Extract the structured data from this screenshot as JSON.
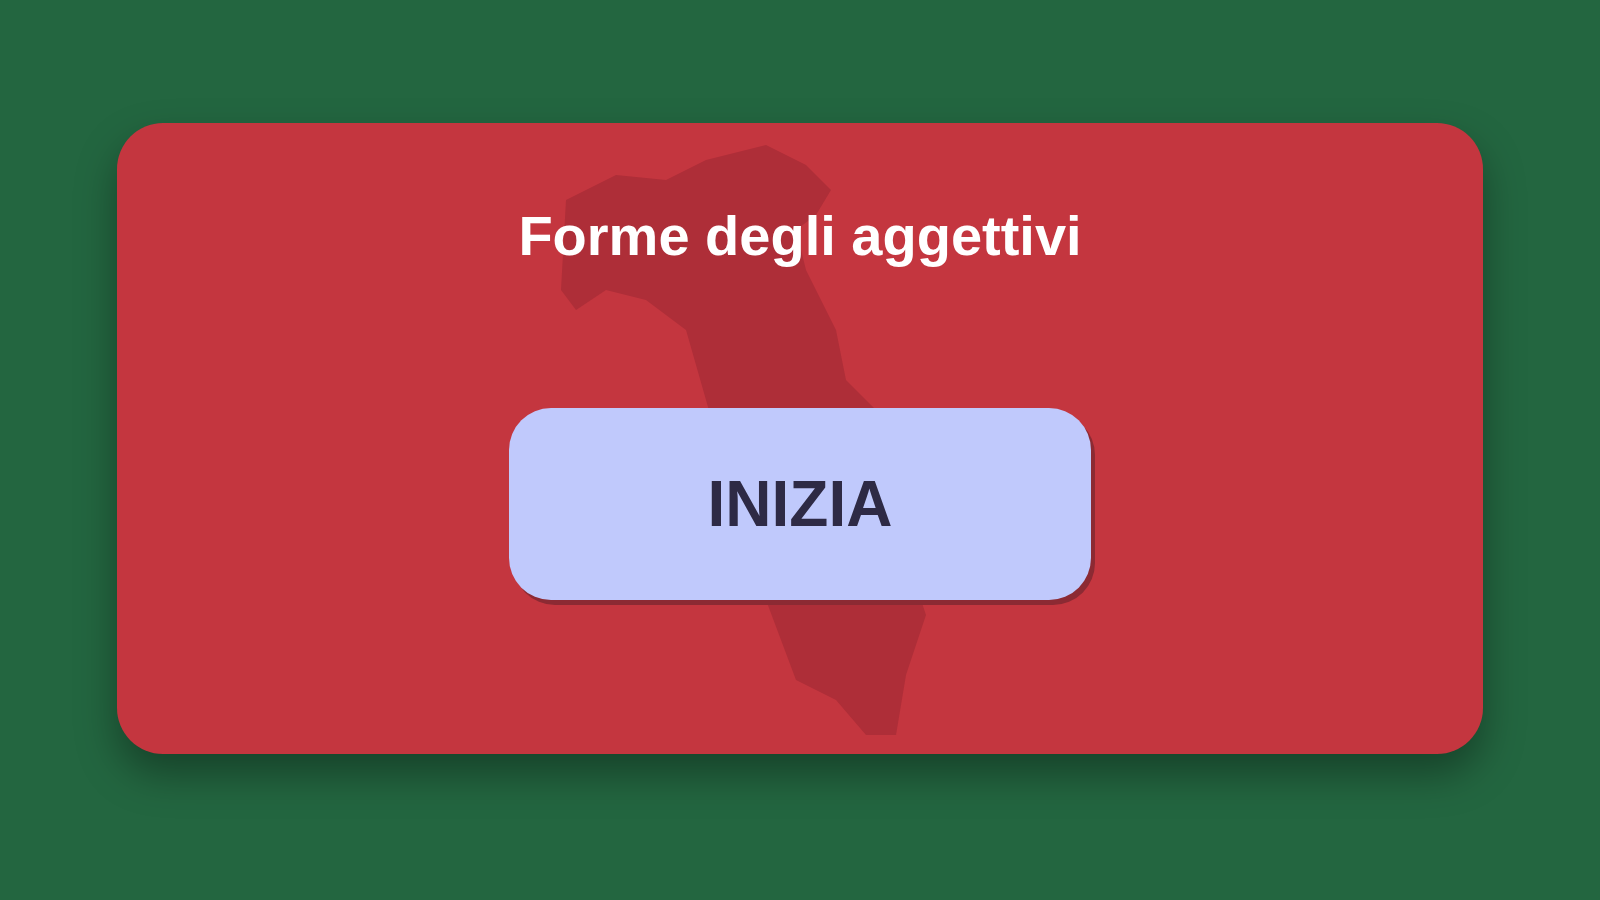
{
  "card": {
    "title": "Forme degli aggettivi",
    "start_button": "INIZIA"
  }
}
